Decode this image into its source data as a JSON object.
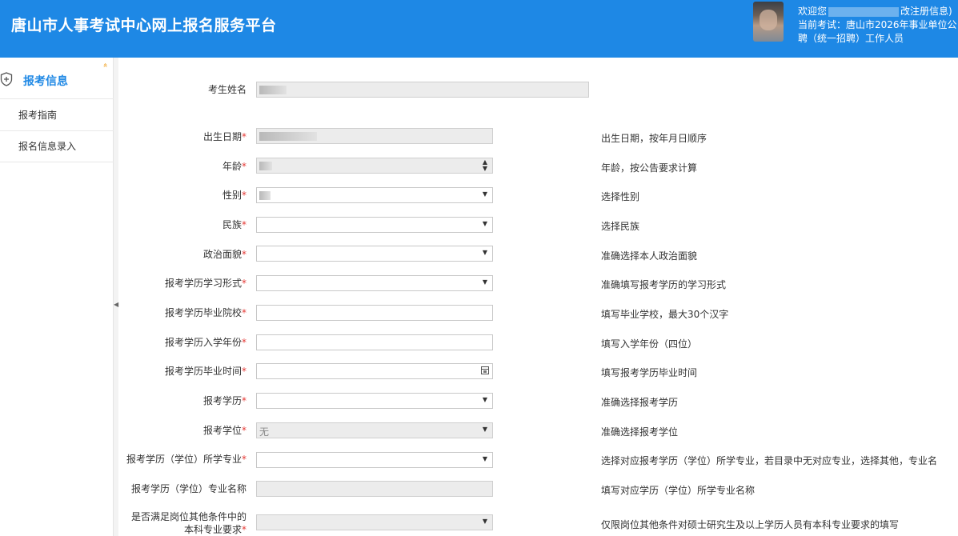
{
  "header": {
    "title": "唐山市人事考试中心网上报名服务平台",
    "welcome": "欢迎您",
    "edit_link": "改注册信息)",
    "current_exam_line1": "当前考试：唐山市2026年事业单位公",
    "current_exam_line2": "聘（统一招聘）工作人员"
  },
  "sidebar": {
    "title": "报考信息",
    "collapse": "»",
    "items": [
      {
        "label": "报考指南"
      },
      {
        "label": "报名信息录入"
      }
    ]
  },
  "form": {
    "fields": [
      {
        "label": "考生姓名",
        "required": false,
        "type": "text-disabled",
        "hint": ""
      },
      {
        "label": "出生日期",
        "required": true,
        "type": "text-disabled",
        "hint": "出生日期，按年月日顺序"
      },
      {
        "label": "年龄",
        "required": true,
        "type": "number-disabled",
        "hint": "年龄，按公告要求计算"
      },
      {
        "label": "性别",
        "required": true,
        "type": "select",
        "hint": "选择性别"
      },
      {
        "label": "民族",
        "required": true,
        "type": "select",
        "hint": "选择民族"
      },
      {
        "label": "政治面貌",
        "required": true,
        "type": "select",
        "hint": "准确选择本人政治面貌"
      },
      {
        "label": "报考学历学习形式",
        "required": true,
        "type": "select",
        "hint": "准确填写报考学历的学习形式"
      },
      {
        "label": "报考学历毕业院校",
        "required": true,
        "type": "text",
        "hint": "填写毕业学校，最大30个汉字"
      },
      {
        "label": "报考学历入学年份",
        "required": true,
        "type": "text",
        "hint": "填写入学年份（四位）"
      },
      {
        "label": "报考学历毕业时间",
        "required": true,
        "type": "date",
        "hint": "填写报考学历毕业时间"
      },
      {
        "label": "报考学历",
        "required": true,
        "type": "select",
        "hint": "准确选择报考学历"
      },
      {
        "label": "报考学位",
        "required": true,
        "type": "select-disabled",
        "value": "无",
        "hint": "准确选择报考学位"
      },
      {
        "label": "报考学历（学位）所学专业",
        "required": true,
        "type": "select",
        "hint": "选择对应报考学历（学位）所学专业，若目录中无对应专业，选择其他，专业名"
      },
      {
        "label": "报考学历（学位）专业名称",
        "required": false,
        "type": "text-disabled",
        "hint": "填写对应学历（学位）所学专业名称"
      },
      {
        "label": "是否满足岗位其他条件中的",
        "label2": "本科专业要求",
        "required": true,
        "type": "select-disabled",
        "hint": "仅限岗位其他条件对硕士研究生及以上学历人员有本科专业要求的填写"
      }
    ]
  },
  "colors": {
    "header_bg": "#1e88e5",
    "accent": "#1e88e5",
    "required": "#e53935"
  }
}
